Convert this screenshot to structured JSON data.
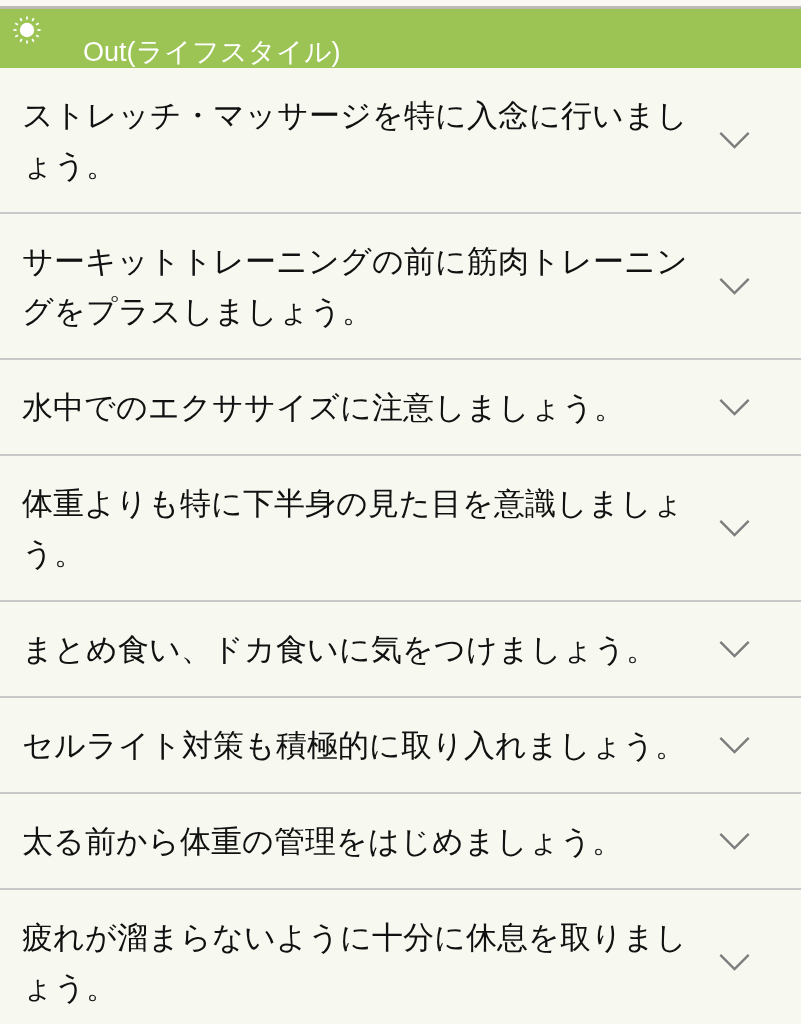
{
  "header": {
    "title": "Out(ライフスタイル)"
  },
  "items": [
    {
      "text": "ストレッチ・マッサージを特に入念に行いましょう。"
    },
    {
      "text": "サーキットトレーニングの前に筋肉トレーニングをプラスしましょう。"
    },
    {
      "text": "水中でのエクササイズに注意しましょう。"
    },
    {
      "text": "体重よりも特に下半身の見た目を意識しましょう。"
    },
    {
      "text": "まとめ食い、ドカ食いに気をつけましょう。"
    },
    {
      "text": "セルライト対策も積極的に取り入れましょう。"
    },
    {
      "text": "太る前から体重の管理をはじめましょう。"
    },
    {
      "text": "疲れが溜まらないように十分に休息を取りましょう。"
    }
  ]
}
